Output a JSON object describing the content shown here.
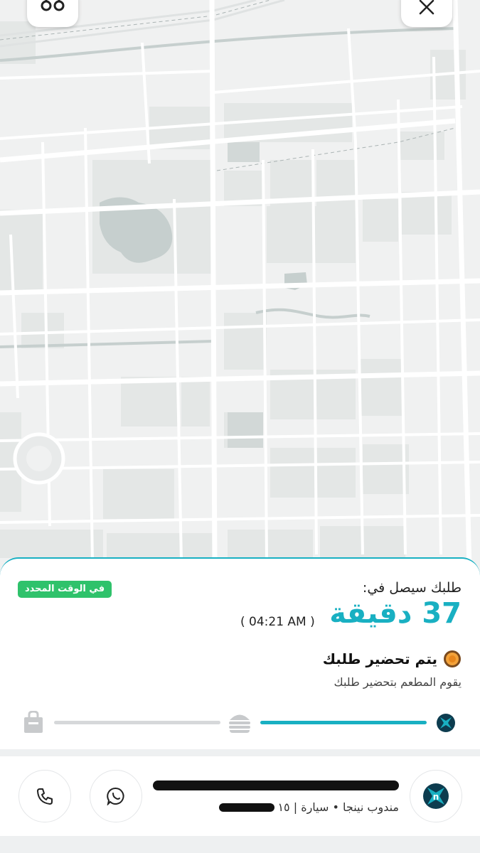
{
  "header": {
    "left_icon": "delivery-helmet-icon",
    "close_icon": "close-icon"
  },
  "order": {
    "arrival_label": "طلبك سيصل في:",
    "on_time_badge": "في الوقت المحدد",
    "eta_minutes": "37 دقيقة",
    "eta_time": "( 04:21 AM )",
    "status_title": "يتم تحضير طلبك",
    "status_subtitle": "يقوم المطعم بتحضير طلبك",
    "progress_fraction": 0.5,
    "steps": [
      "ninja-logo-icon",
      "burger-icon",
      "bag-icon"
    ]
  },
  "agent": {
    "role_line": "مندوب نينجا • سيارة | ١٥",
    "call_icon": "phone-icon",
    "chat_icon": "whatsapp-icon"
  },
  "colors": {
    "accent": "#19b0c2",
    "badge": "#2fc26b",
    "dark": "#0d3c4f"
  }
}
